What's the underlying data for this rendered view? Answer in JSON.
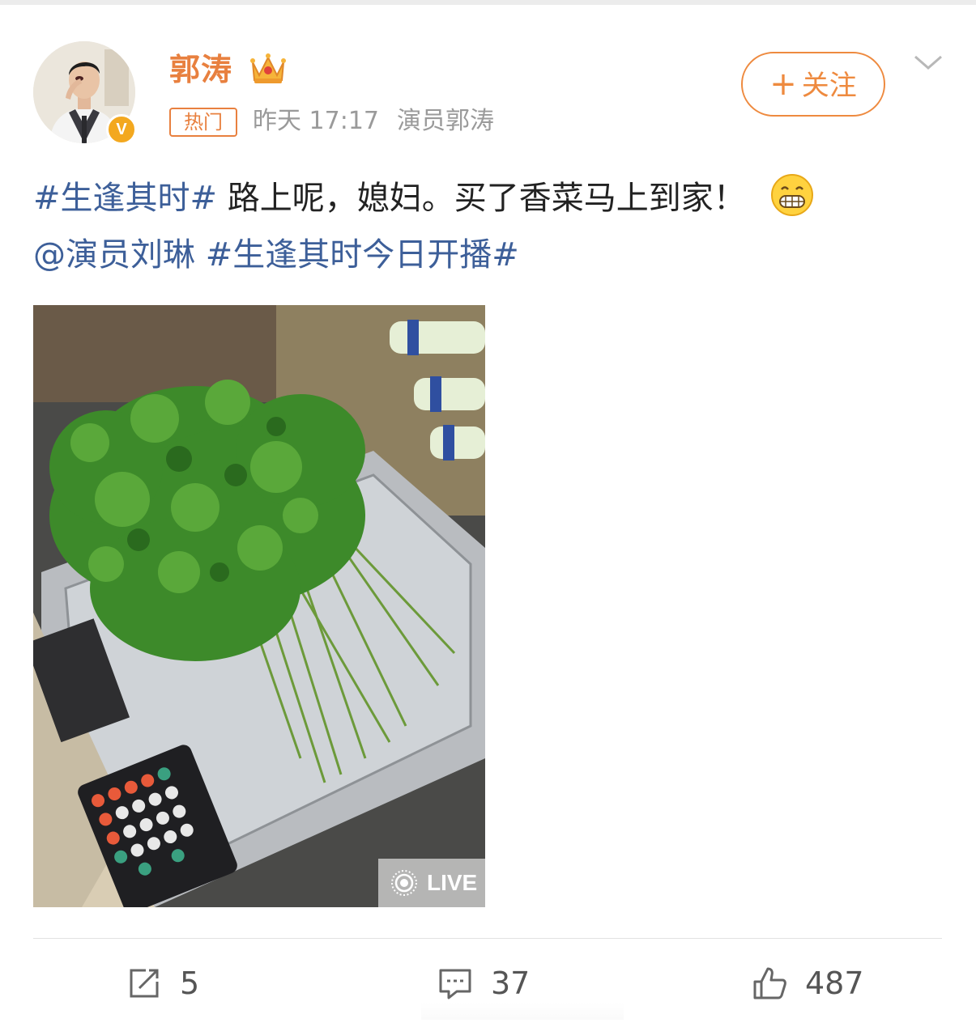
{
  "post": {
    "username": "郭涛",
    "badge": "热门",
    "time": "昨天 17:17",
    "source": "演员郭涛",
    "follow_label": "关注",
    "hashtag1": "#生逢其时#",
    "body": " 路上呢，媳妇。买了香菜马上到家！",
    "mention": "@演员刘琳",
    "hashtag2": "#生逢其时今日开播#",
    "live_label": "LIVE"
  },
  "actions": {
    "repost_count": "5",
    "comment_count": "37",
    "like_count": "487"
  },
  "icons": {
    "crown": "crown-icon",
    "verified": "verified-icon",
    "chevron": "chevron-down-icon",
    "emoji": "grin-emoji-icon",
    "live": "live-photo-icon",
    "repost": "repost-icon",
    "comment": "comment-icon",
    "like": "thumbs-up-icon"
  },
  "colors": {
    "accent": "#e8803f",
    "link": "#3d5f99",
    "meta": "#9a9a9a"
  }
}
